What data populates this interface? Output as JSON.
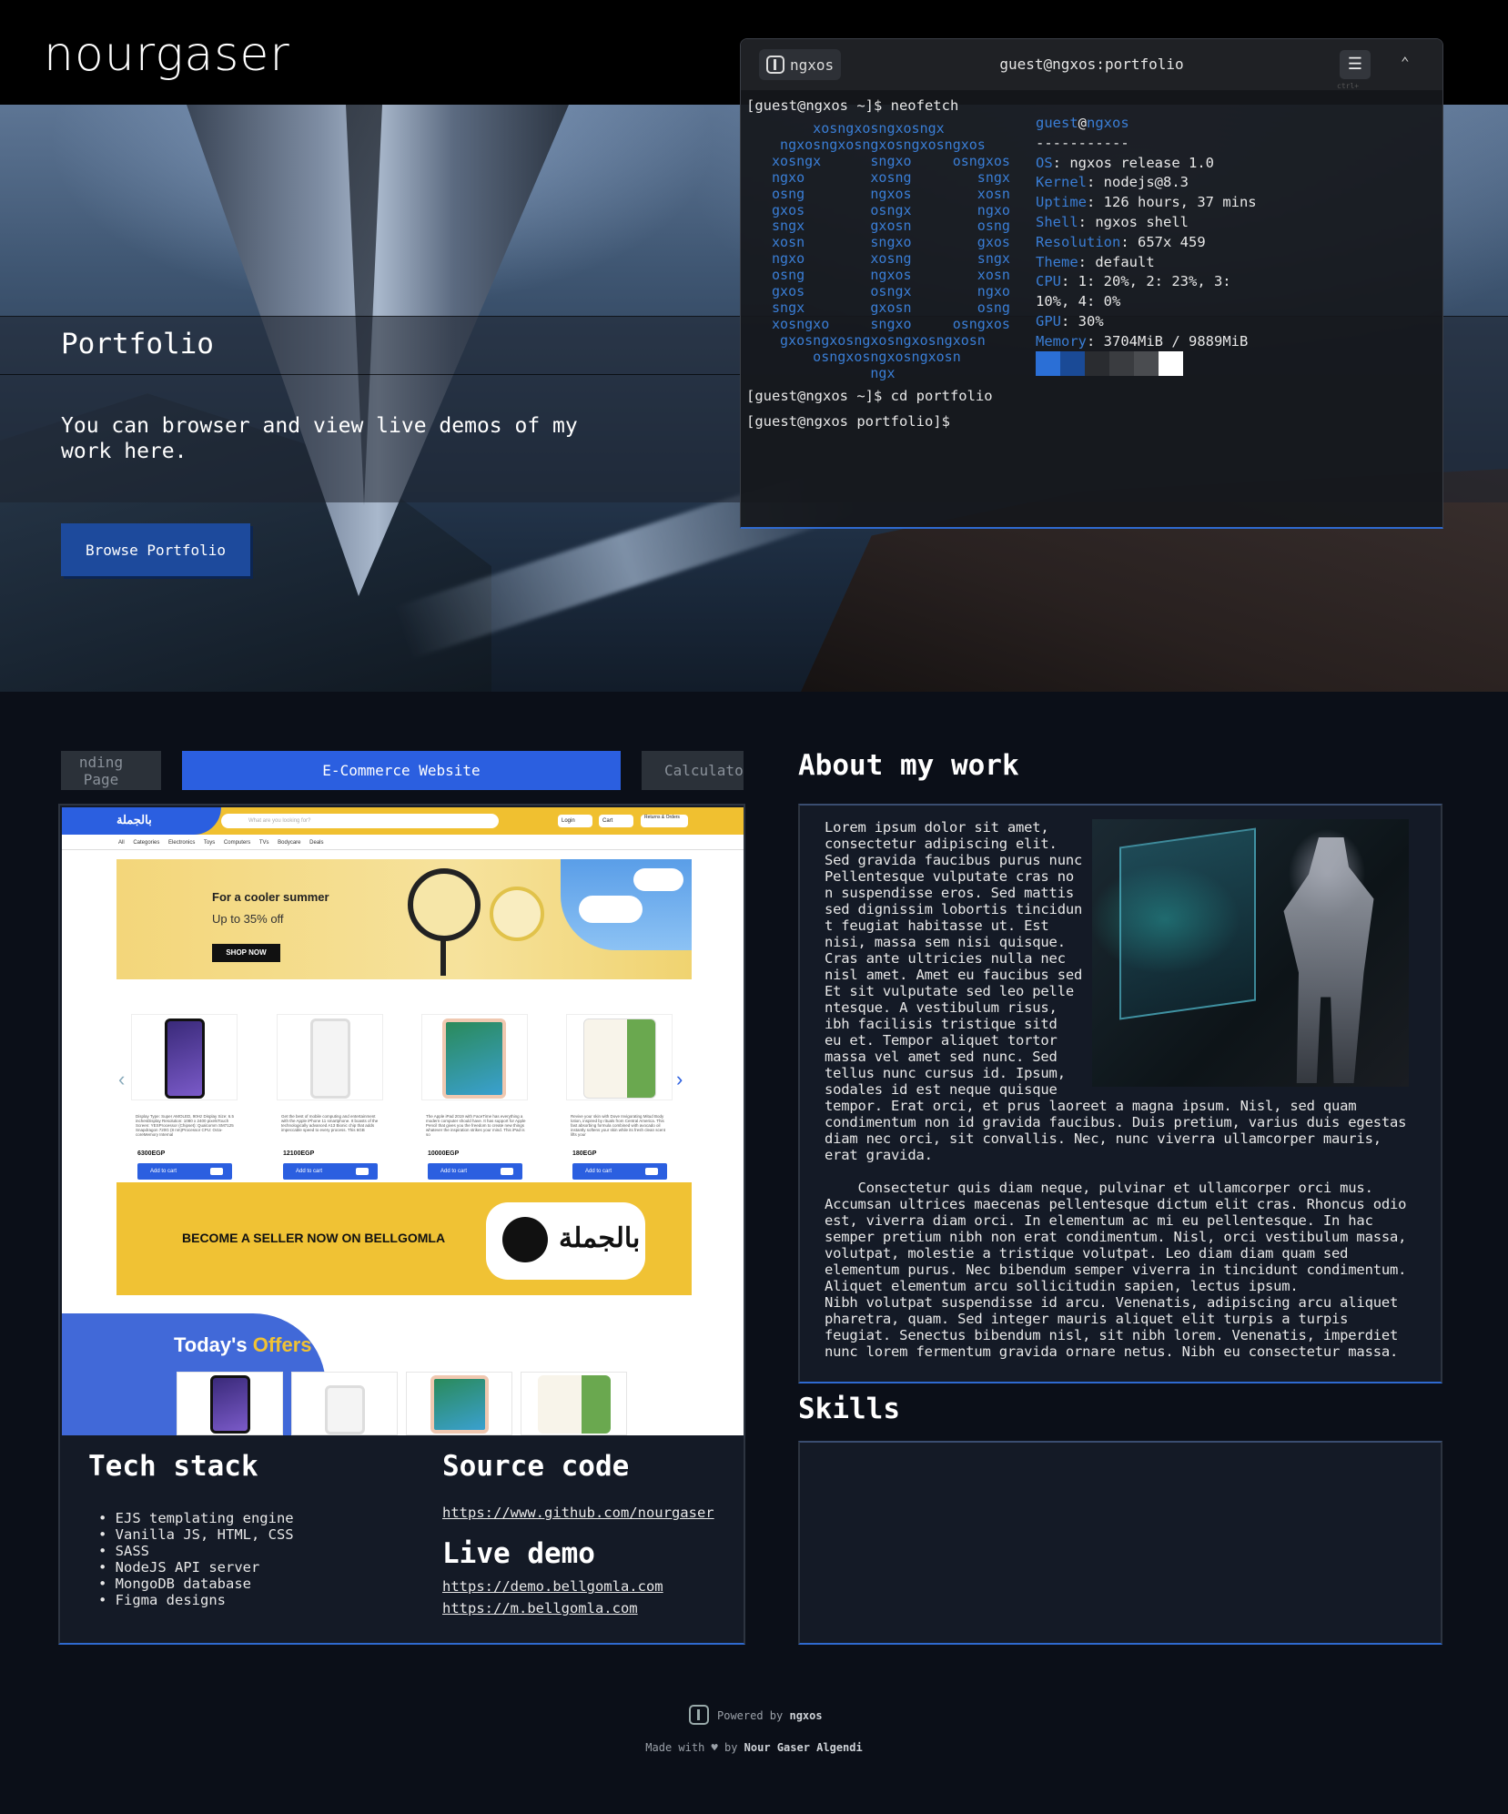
{
  "header": {
    "logo": "nourgaser"
  },
  "hero": {
    "title": "Portfolio",
    "subtitle": "You can browser and view live demos of my work here.",
    "button_label": "Browse Portfolio"
  },
  "terminal": {
    "brand_label": "ngxos",
    "title": "guest@ngxos:portfolio",
    "menu_shortcut": "ctrl+",
    "lines": [
      "[guest@ngxos ~]$ neofetch",
      "[guest@ngxos ~]$ cd portfolio",
      "[guest@ngxos portfolio]$"
    ],
    "ascii_art": "      xosngxosngxosngx\n  ngxosngxosngxosngxosngxos\n xosngx      sngxo     osngxos\n ngxo        xosng        sngx\n osng        ngxos        xosn\n gxos        osngx        ngxo\n sngx        gxosn        osng\n xosn        sngxo        gxos\n ngxo        xosng        sngx\n osng        ngxos        xosn\n gxos        osngx        ngxo\n sngx        gxosn        osng\n xosngxo     sngxo     osngxos\n  gxosngxosngxosngxosngxosn\n      osngxosngxosngxosn\n             ngx",
    "neofetch": {
      "user": "guest",
      "at": "@",
      "host": "ngxos",
      "separator": "-----------",
      "os_key": "OS",
      "os": "ngxos release 1.0",
      "kernel_key": "Kernel",
      "kernel": "nodejs@8.3",
      "uptime_key": "Uptime",
      "uptime": "126 hours, 37 mins",
      "shell_key": "Shell",
      "shell": "ngxos shell",
      "resolution_key": "Resolution",
      "resolution": "657x 459",
      "theme_key": "Theme",
      "theme": "default",
      "cpu_key": "CPU",
      "cpu": "1: 20%, 2: 23%, 3:",
      "cpu_cont": "10%, 4: 0%",
      "gpu_key": "GPU",
      "gpu": "30%",
      "memory_key": "Memory",
      "memory": "3704MiB / 9889MiB"
    },
    "swatch_colors": [
      "#2b6fd6",
      "#1a4a96",
      "#2a2c30",
      "#3a3c40",
      "#4a4c50",
      "#ffffff"
    ]
  },
  "portfolio": {
    "tabs": [
      "nding Page",
      "E-Commerce Website",
      "Calculator"
    ],
    "screenshot": {
      "logo": "بالجملة",
      "search_placeholder": "What are you looking for?",
      "login": "Login",
      "cart": "Cart",
      "returns": "Returns & Orders",
      "nav": "All Categories  Electronics  Toys  Computers  TVs  Bodycare  Deals",
      "promo_line1": "For a cooler summer",
      "promo_line2": "Up to 35% off",
      "promo_button": "SHOP NOW",
      "products": [
        {
          "desc": "Display Type: Super AMOLED, 90Hz Display Size: 6.5 inchesDisplay Resolution: 1080 x 2400 pixelsTouch Screen: YESProcessor (Chipset): Qualcomm SM7125 Snapdragon 720G (8 nm)Processor CPU: Octa-coreMemory Internal",
          "price": "6300EGP",
          "cart": "Add to cart"
        },
        {
          "desc": "Get the best of mobile computing and entertainment with the Apple iPhone 11 smartphone. It boasts of the technologically advanced A13 Bionic chip that adds impeccable speed to every process. This 6GB",
          "price": "12100EGP",
          "cart": "Add to cart"
        },
        {
          "desc": "The Apple iPad 2019 with FaceTime has everything a modern computer should have. It has support for Apple Pencil that gives you the freedom to create new things whatever the inspiration strikes your mind. This iPad is so",
          "price": "10000EGP",
          "cart": "Add to cart"
        },
        {
          "desc": "Revive your skin with Dove Invigorating Mitud Body lotion, inspired by rituals from Central America. This fast absorbing formula combined with avocado oil instantly softens your skin while its fresh clean scent lifts your",
          "price": "180EGP",
          "cart": "Add to cart"
        }
      ],
      "seller_text": "BECOME A SELLER NOW ON BELLGOMLA",
      "seller_logo": "بالجملة",
      "offers_prefix": "Today's ",
      "offers_word": "Offers"
    },
    "tech_stack_title": "Tech stack",
    "tech_stack": [
      "EJS templating engine",
      "Vanilla JS, HTML, CSS",
      "SASS",
      "NodeJS API server",
      "MongoDB database",
      "Figma designs"
    ],
    "source_title": "Source code",
    "source_link": "https://www.github.com/nourgaser",
    "demo_title": "Live demo",
    "demo_link1": "https://demo.bellgomla.com",
    "demo_link2": "https://m.bellgomla.com"
  },
  "about": {
    "title": "About my work",
    "text": "Lorem ipsum dolor sit amet,\nconsectetur adipiscing elit.\nSed gravida faucibus purus nunc\nPellentesque vulputate cras no\nn suspendisse eros. Sed mattis\nsed dignissim lobortis tincidun\nt feugiat habitasse ut. Est\nnisi, massa sem nisi quisque.\nCras ante ultricies nulla nec\nnisl amet. Amet eu faucibus sed\nEt sit vulputate sed leo pelle\nntesque. A vestibulum risus,\nibh facilisis tristique sitd\neu et. Tempor aliquet tortor\nmassa vel amet sed nunc. Sed\ntellus nunc cursus id. Ipsum,\nsodales id est neque quisque\ntempor. Erat orci, et prus laoreet a magna ipsum. Nisl, sed quam\ncondimentum non id gravida faucibus. Duis pretium, varius duis egestas\ndiam nec orci, sit convallis. Nec, nunc viverra ullamcorper mauris,\nerat gravida.\n\n    Consectetur quis diam neque, pulvinar et ullamcorper orci mus.\nAccumsan ultrices maecenas pellentesque dictum elit cras. Rhoncus odio\nest, viverra diam orci. In elementum ac mi eu pellentesque. In hac\nsemper pretium nibh non erat condimentum. Nisl, orci vestibulum massa,\nvolutpat, molestie a tristique volutpat. Leo diam diam quam sed\nelementum purus. Nec bibendum semper viverra in tincidunt condimentum.\nAliquet elementum arcu sollicitudin sapien, lectus ipsum.\nNibh volutpat suspendisse id arcu. Venenatis, adipiscing arcu aliquet\npharetra, quam. Sed integer mauris aliquet elit turpis a turpis\nfeugiat. Senectus bibendum nisl, sit nibh lorem. Venenatis, imperdiet\nnunc lorem fermentum gravida ornare netus. Nibh eu consectetur massa."
  },
  "skills": {
    "title": "Skills"
  },
  "footer": {
    "powered_prefix": "Powered by ",
    "powered_name": "ngxos",
    "made_prefix": "Made with ",
    "heart": "♥",
    "made_by": " by ",
    "author": "Nour Gaser Algendi"
  },
  "colors": {
    "accent": "#2b5fe0",
    "background": "#0b0f18",
    "panel": "#141a26",
    "terminal_blue": "#3a7ed6"
  }
}
